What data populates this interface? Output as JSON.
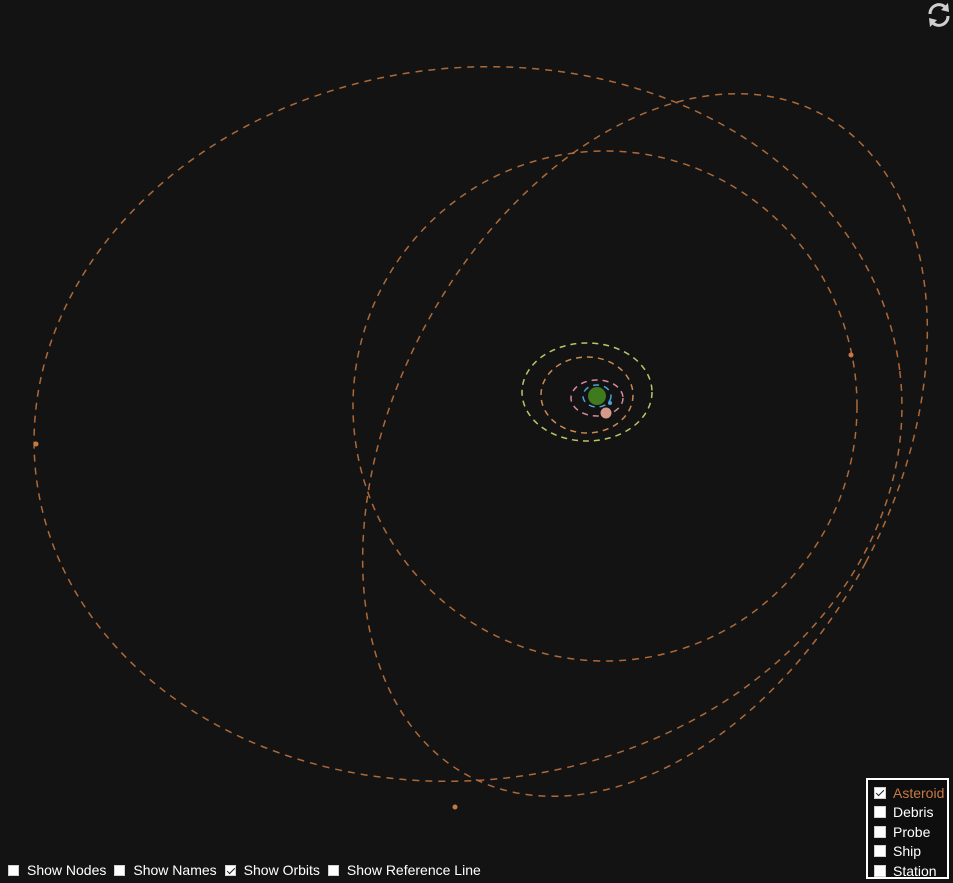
{
  "controls": {
    "refresh_icon": "refresh-icon",
    "options": [
      {
        "label": "Show Nodes",
        "checked": false
      },
      {
        "label": "Show Names",
        "checked": false
      },
      {
        "label": "Show Orbits",
        "checked": true
      },
      {
        "label": "Show Reference Line",
        "checked": false
      }
    ]
  },
  "legend": {
    "items": [
      {
        "label": "Asteroid",
        "checked": true
      },
      {
        "label": "Debris",
        "checked": false
      },
      {
        "label": "Probe",
        "checked": false
      },
      {
        "label": "Ship",
        "checked": false
      },
      {
        "label": "Station",
        "checked": false
      }
    ]
  },
  "colors": {
    "background": "#131313",
    "asteroid_orbit": "#c87941",
    "planet": "#3f7a1f",
    "moon_orbit_outer": "#b7c76a",
    "moon_orbit_mid": "#c98a4f",
    "moon_orbit_pink": "#d58a9a",
    "moon_orbit_blue": "#4aa3d8",
    "moon": "#d69a8a"
  }
}
